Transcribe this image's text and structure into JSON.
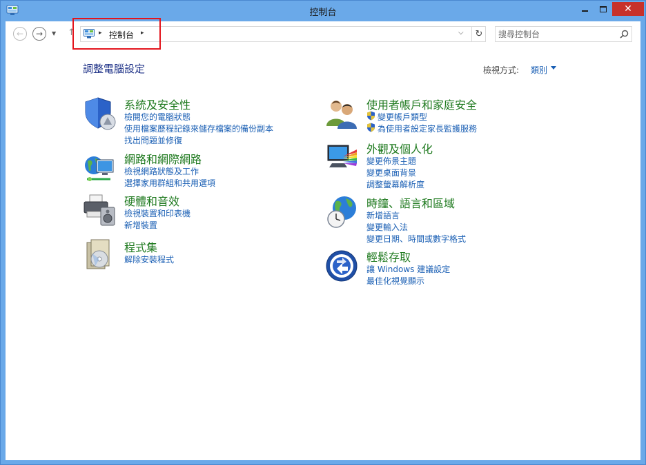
{
  "window": {
    "title": "控制台",
    "close_glyph": "✕"
  },
  "nav": {
    "back_glyph": "←",
    "forward_glyph": "→",
    "recent_glyph": "▼",
    "up_glyph": "↑"
  },
  "address": {
    "crumb": "控制台",
    "separator": "▸",
    "dropdown_glyph": "⌵",
    "refresh_glyph": "↻"
  },
  "search": {
    "placeholder": "搜尋控制台"
  },
  "header": {
    "title": "調整電腦設定",
    "view_label": "檢視方式:",
    "view_value": "類別"
  },
  "categories_left": [
    {
      "title": "系統及安全性",
      "icon": "shield-icon",
      "links": [
        "檢閱您的電腦狀態",
        "使用檔案歷程記錄來儲存檔案的備份副本",
        "找出問題並修復"
      ]
    },
    {
      "title": "網路和網際網路",
      "icon": "network-icon",
      "links": [
        "檢視網路狀態及工作",
        "選擇家用群組和共用選項"
      ]
    },
    {
      "title": "硬體和音效",
      "icon": "printer-speaker-icon",
      "links": [
        "檢視裝置和印表機",
        "新增裝置"
      ]
    },
    {
      "title": "程式集",
      "icon": "programs-icon",
      "links": [
        "解除安裝程式"
      ]
    }
  ],
  "categories_right": [
    {
      "title": "使用者帳戶和家庭安全",
      "icon": "users-icon",
      "links": [
        "變更帳戶類型",
        "為使用者設定家長監護服務"
      ]
    },
    {
      "title": "外觀及個人化",
      "icon": "monitor-colors-icon",
      "links": [
        "變更佈景主題",
        "變更桌面背景",
        "調整螢幕解析度"
      ]
    },
    {
      "title": "時鐘、語言和區域",
      "icon": "globe-clock-icon",
      "links": [
        "新增語言",
        "變更輸入法",
        "變更日期、時間或數字格式"
      ]
    },
    {
      "title": "輕鬆存取",
      "icon": "ease-of-access-icon",
      "links": [
        "讓 Windows 建議設定",
        "最佳化視覺顯示"
      ]
    }
  ],
  "colors": {
    "title_bar": "#6aa9e9",
    "close_button": "#c7312a",
    "category_title": "#1f7a1f",
    "link": "#1a5fb4",
    "page_title": "#1e3287",
    "highlight_box": "#e3141c"
  }
}
